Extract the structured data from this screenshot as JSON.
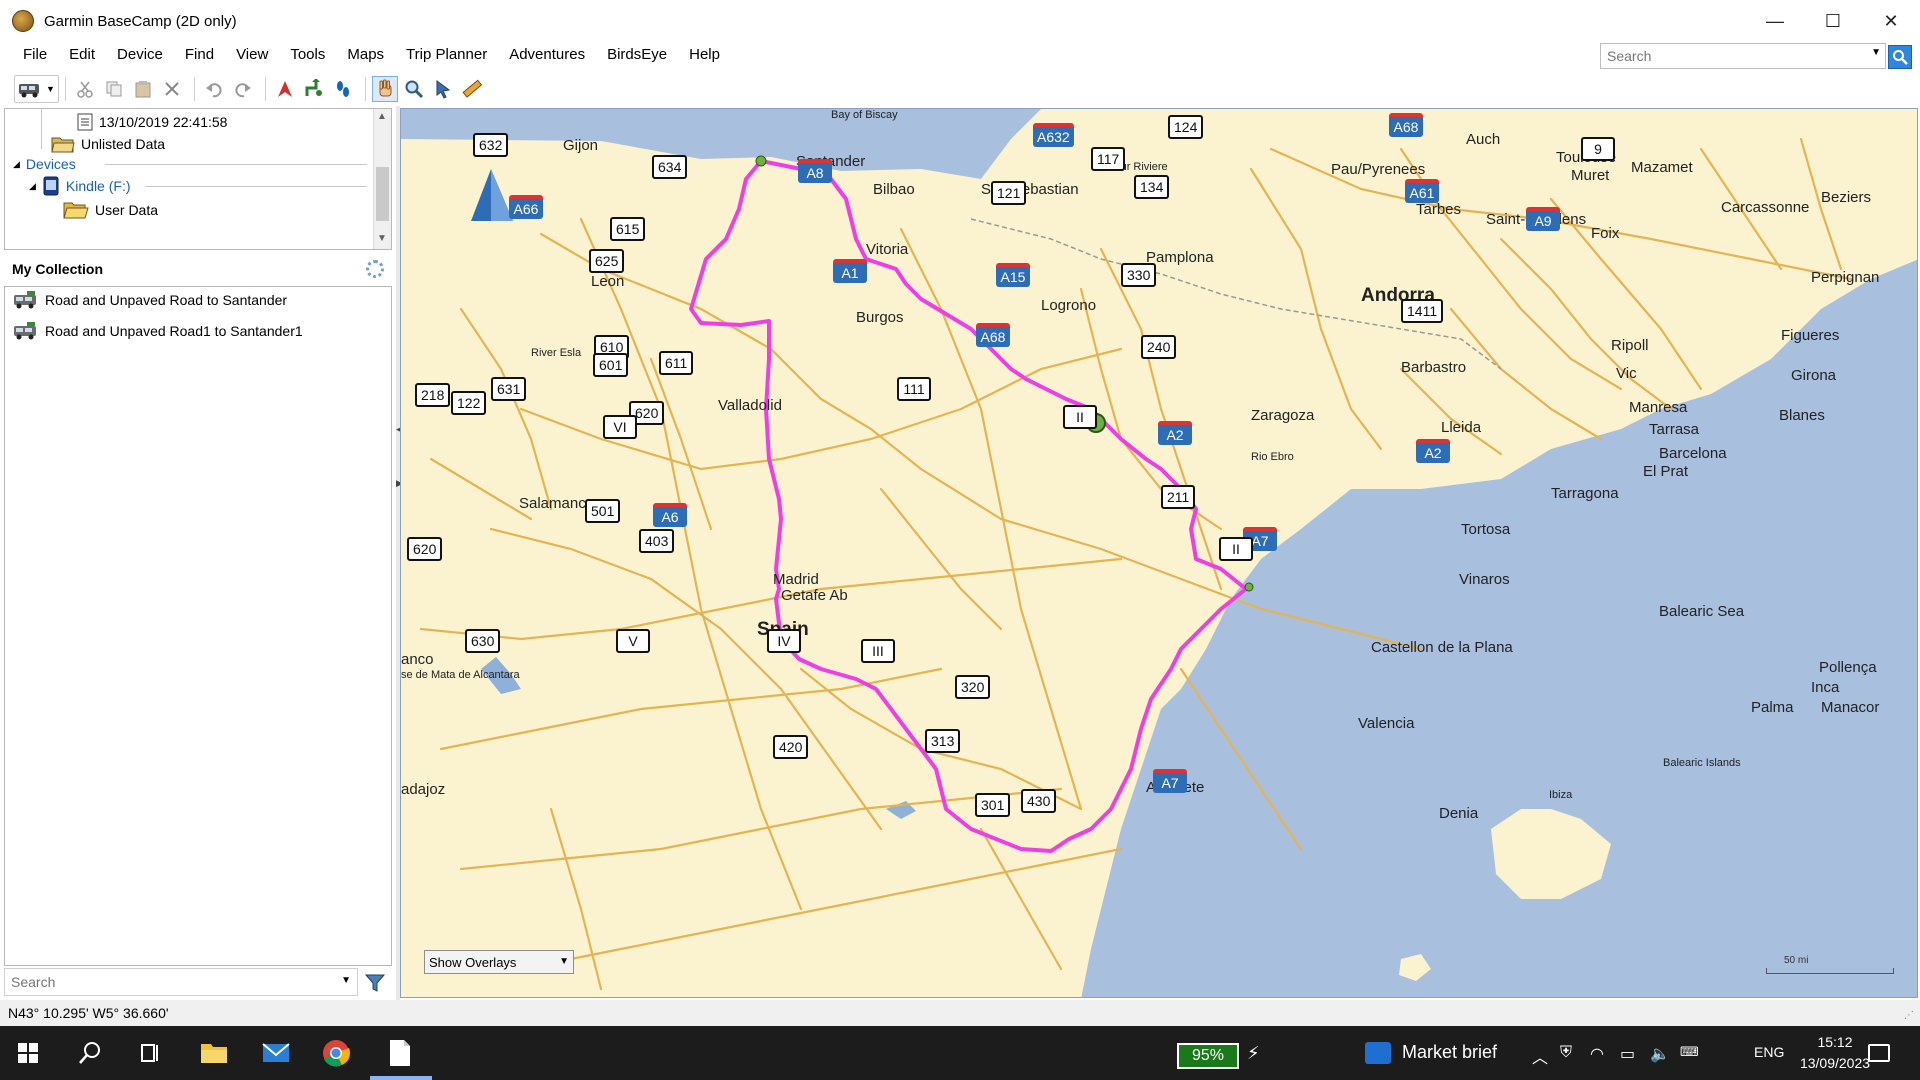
{
  "window": {
    "title": "Garmin BaseCamp (2D only)",
    "minimize": "—",
    "maximize": "☐",
    "close": "✕"
  },
  "menu": [
    "File",
    "Edit",
    "Device",
    "Find",
    "View",
    "Tools",
    "Maps",
    "Trip Planner",
    "Adventures",
    "BirdsEye",
    "Help"
  ],
  "top_search": {
    "placeholder": "Search"
  },
  "tree": {
    "date_item": "13/10/2019 22:41:58",
    "unlisted": "Unlisted Data",
    "devices": "Devices",
    "kindle": "Kindle (F:)",
    "user_data": "User Data"
  },
  "collection": {
    "header": "My Collection",
    "items": [
      "Road and Unpaved Road to Santander",
      "Road and Unpaved Road1 to Santander1"
    ]
  },
  "left_search": {
    "placeholder": "Search"
  },
  "map": {
    "overlay_option": "Show Overlays",
    "scale": "50 mi",
    "colors": {
      "sea": "#a9bfde",
      "land": "#fbf3d0",
      "road": "#e3b451",
      "route": "#ee3fe6",
      "motorway_shield": "#2d6db5"
    },
    "places": [
      "Bay of Biscay",
      "Gijon",
      "Santander",
      "Bilbao",
      "San Sebastian",
      "Adour Riviere",
      "Auch",
      "Toulouse",
      "Muret",
      "Mazamet",
      "Beziers",
      "Carcassonne",
      "Foix",
      "Saint-Gaudens",
      "Tarbes",
      "Pau/Pyrenees",
      "Vitoria",
      "Pamplona",
      "Logrono",
      "Leon",
      "River Esla",
      "Burgos",
      "Valladolid",
      "Andorra",
      "Perpignan",
      "Figueres",
      "Ripoll",
      "Vic",
      "Girona",
      "Manresa",
      "Tarrasa",
      "Blanes",
      "Barcelona",
      "El Prat",
      "Barbastro",
      "Lleida",
      "Zaragoza",
      "Rio Ebro",
      "Tarragona",
      "Tortosa",
      "Vinaros",
      "Salamanca",
      "Madrid",
      "Getafe Ab",
      "Spain",
      "Castellon de la Plana",
      "Balearic Sea",
      "Pollença",
      "Inca",
      "Palma",
      "Manacor",
      "Balearic Islands",
      "Valencia",
      "Ibiza",
      "Denia",
      "Albacete",
      "ancо",
      "se de Mata de Alcantara",
      "adajoz"
    ],
    "shields": [
      "632",
      "634",
      "A66",
      "A8",
      "A632",
      "117",
      "124",
      "A68",
      "9",
      "121",
      "134",
      "A61",
      "A9",
      "615",
      "625",
      "A1",
      "A15",
      "330",
      "1411",
      "610",
      "611",
      "601",
      "A68",
      "240",
      "631",
      "218",
      "122",
      "620",
      "111",
      "VI",
      "II",
      "A2",
      "A2",
      "211",
      "501",
      "A6",
      "403",
      "A7",
      "620",
      "II",
      "630",
      "V",
      "IV",
      "III",
      "320",
      "313",
      "420",
      "301",
      "430",
      "A7"
    ]
  },
  "status": {
    "coords": "N43° 10.295' W5° 36.660'"
  },
  "taskbar": {
    "battery": "95%",
    "market": "Market brief",
    "lang": "ENG",
    "time": "15:12",
    "date": "13/09/2023"
  }
}
